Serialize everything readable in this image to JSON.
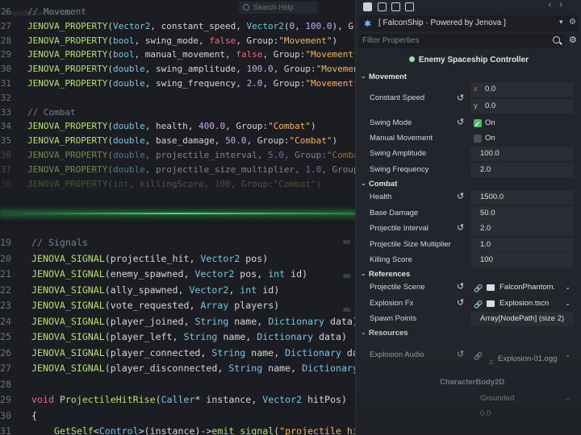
{
  "editor": {
    "ghost_title": "ProjectileController.cpp",
    "search_placeholder": "Search Help",
    "top_lines": [
      {
        "n": "26",
        "tokens": [
          [
            "cm",
            "// Movement"
          ]
        ]
      },
      {
        "n": "27",
        "tokens": [
          [
            "fn",
            "JENOVA_PROPERTY"
          ],
          [
            "pl",
            "("
          ],
          [
            "ty",
            "Vector2"
          ],
          [
            "pl",
            ", constant_speed, "
          ],
          [
            "ty",
            "Vector2"
          ],
          [
            "pl",
            "("
          ],
          [
            "num",
            "0"
          ],
          [
            "pl",
            ", "
          ],
          [
            "num",
            "100.0"
          ],
          [
            "pl",
            "), Group:"
          ]
        ]
      },
      {
        "n": "28",
        "tokens": [
          [
            "fn",
            "JENOVA_PROPERTY"
          ],
          [
            "pl",
            "("
          ],
          [
            "ty",
            "bool"
          ],
          [
            "pl",
            ", swing_mode, "
          ],
          [
            "kw",
            "false"
          ],
          [
            "pl",
            ", Group:"
          ],
          [
            "str",
            "\"Movement\""
          ],
          [
            "pl",
            ")"
          ]
        ]
      },
      {
        "n": "29",
        "tokens": [
          [
            "fn",
            "JENOVA_PROPERTY"
          ],
          [
            "pl",
            "("
          ],
          [
            "ty",
            "bool"
          ],
          [
            "pl",
            ", manual_movement, "
          ],
          [
            "kw",
            "false"
          ],
          [
            "pl",
            ", Group:"
          ],
          [
            "str",
            "\"Movement\""
          ],
          [
            "pl",
            ")"
          ]
        ]
      },
      {
        "n": "30",
        "tokens": [
          [
            "fn",
            "JENOVA_PROPERTY"
          ],
          [
            "pl",
            "("
          ],
          [
            "ty",
            "double"
          ],
          [
            "pl",
            ", swing_amplitude, "
          ],
          [
            "num",
            "100.0"
          ],
          [
            "pl",
            ", Group:"
          ],
          [
            "str",
            "\"Movement\""
          ],
          [
            "pl",
            ")"
          ]
        ]
      },
      {
        "n": "31",
        "tokens": [
          [
            "fn",
            "JENOVA_PROPERTY"
          ],
          [
            "pl",
            "("
          ],
          [
            "ty",
            "double"
          ],
          [
            "pl",
            ", swing_frequency, "
          ],
          [
            "num",
            "2.0"
          ],
          [
            "pl",
            ", Group:"
          ],
          [
            "str",
            "\"Movement\""
          ],
          [
            "pl",
            ")"
          ]
        ]
      },
      {
        "n": "32",
        "tokens": []
      },
      {
        "n": "33",
        "tokens": [
          [
            "cm",
            "// Combat"
          ]
        ]
      },
      {
        "n": "34",
        "tokens": [
          [
            "fn",
            "JENOVA_PROPERTY"
          ],
          [
            "pl",
            "("
          ],
          [
            "ty",
            "double"
          ],
          [
            "pl",
            ", health, "
          ],
          [
            "num",
            "400.0"
          ],
          [
            "pl",
            ", Group:"
          ],
          [
            "str",
            "\"Combat\""
          ],
          [
            "pl",
            ")"
          ]
        ]
      },
      {
        "n": "35",
        "tokens": [
          [
            "fn",
            "JENOVA_PROPERTY"
          ],
          [
            "pl",
            "("
          ],
          [
            "ty",
            "double"
          ],
          [
            "pl",
            ", base_damage, "
          ],
          [
            "num",
            "50.0"
          ],
          [
            "pl",
            ", Group:"
          ],
          [
            "str",
            "\"Combat\""
          ],
          [
            "pl",
            ")"
          ]
        ]
      },
      {
        "n": "36",
        "fade": "fade-1",
        "tokens": [
          [
            "fn",
            "JENOVA_PROPERTY"
          ],
          [
            "pl",
            "("
          ],
          [
            "ty",
            "double"
          ],
          [
            "pl",
            ", projectile_interval, "
          ],
          [
            "num",
            "5.0"
          ],
          [
            "pl",
            ", Group:"
          ],
          [
            "str",
            "\"Combat\""
          ],
          [
            "pl",
            ")"
          ]
        ]
      },
      {
        "n": "37",
        "fade": "fade-1",
        "tokens": [
          [
            "fn",
            "JENOVA_PROPERTY"
          ],
          [
            "pl",
            "("
          ],
          [
            "ty",
            "double"
          ],
          [
            "pl",
            ", projectile_size_multiplier, "
          ],
          [
            "num",
            "1.0"
          ],
          [
            "pl",
            ", Group:"
          ],
          [
            "str",
            "\"Com"
          ]
        ]
      },
      {
        "n": "38",
        "fade": "fade-2",
        "tokens": [
          [
            "fn",
            "JENOVA_PROPERTY"
          ],
          [
            "pl",
            "("
          ],
          [
            "ty",
            "int"
          ],
          [
            "pl",
            ", killingScore, "
          ],
          [
            "num",
            "100"
          ],
          [
            "pl",
            ", Group:"
          ],
          [
            "str",
            "\"Combat\""
          ],
          [
            "pl",
            ")"
          ]
        ]
      }
    ],
    "bottom_lines": [
      {
        "n": "19",
        "tokens": [
          [
            "cm",
            "// Signals"
          ]
        ]
      },
      {
        "n": "20",
        "tokens": [
          [
            "fn",
            "JENOVA_SIGNAL"
          ],
          [
            "pl",
            "(projectile_hit, "
          ],
          [
            "ty",
            "Vector2"
          ],
          [
            "pl",
            " pos)"
          ]
        ]
      },
      {
        "n": "21",
        "tokens": [
          [
            "fn",
            "JENOVA_SIGNAL"
          ],
          [
            "pl",
            "(enemy_spawned, "
          ],
          [
            "ty",
            "Vector2"
          ],
          [
            "pl",
            " pos, "
          ],
          [
            "ty",
            "int"
          ],
          [
            "pl",
            " id)"
          ]
        ]
      },
      {
        "n": "22",
        "tokens": [
          [
            "fn",
            "JENOVA_SIGNAL"
          ],
          [
            "pl",
            "(ally_spawned, "
          ],
          [
            "ty",
            "Vector2"
          ],
          [
            "pl",
            ", "
          ],
          [
            "ty",
            "int"
          ],
          [
            "pl",
            " id)"
          ]
        ]
      },
      {
        "n": "23",
        "tokens": [
          [
            "fn",
            "JENOVA_SIGNAL"
          ],
          [
            "pl",
            "(vote_requested, "
          ],
          [
            "ty",
            "Array"
          ],
          [
            "pl",
            " players)"
          ]
        ]
      },
      {
        "n": "24",
        "tokens": [
          [
            "fn",
            "JENOVA_SIGNAL"
          ],
          [
            "pl",
            "(player_joined, "
          ],
          [
            "ty",
            "String"
          ],
          [
            "pl",
            " name, "
          ],
          [
            "ty",
            "Dictionary"
          ],
          [
            "pl",
            " data)"
          ]
        ]
      },
      {
        "n": "25",
        "tokens": [
          [
            "fn",
            "JENOVA_SIGNAL"
          ],
          [
            "pl",
            "(player_left, "
          ],
          [
            "ty",
            "String"
          ],
          [
            "pl",
            " name, "
          ],
          [
            "ty",
            "Dictionary"
          ],
          [
            "pl",
            " data)"
          ]
        ]
      },
      {
        "n": "26",
        "tokens": [
          [
            "fn",
            "JENOVA_SIGNAL"
          ],
          [
            "pl",
            "(player_connected, "
          ],
          [
            "ty",
            "String"
          ],
          [
            "pl",
            " name, "
          ],
          [
            "ty",
            "Dictionary"
          ],
          [
            "pl",
            " data)"
          ]
        ]
      },
      {
        "n": "27",
        "tokens": [
          [
            "fn",
            "JENOVA_SIGNAL"
          ],
          [
            "pl",
            "(player_disconnected, "
          ],
          [
            "ty",
            "String"
          ],
          [
            "pl",
            " name, "
          ],
          [
            "ty",
            "Dictionary"
          ],
          [
            "pl",
            " data)"
          ]
        ]
      },
      {
        "n": "28",
        "tokens": []
      },
      {
        "n": "29",
        "tokens": [
          [
            "kw",
            "void"
          ],
          [
            "pl",
            " "
          ],
          [
            "fn",
            "ProjectileHitRise"
          ],
          [
            "pl",
            "("
          ],
          [
            "ty",
            "Caller"
          ],
          [
            "pl",
            "* instance, "
          ],
          [
            "ty",
            "Vector2"
          ],
          [
            "pl",
            " hitPos)"
          ]
        ]
      },
      {
        "n": "30",
        "tokens": [
          [
            "pl",
            "{"
          ]
        ]
      },
      {
        "n": "31",
        "tokens": [
          [
            "pl",
            "    "
          ],
          [
            "fn",
            "GetSelf"
          ],
          [
            "pl",
            "<"
          ],
          [
            "ty",
            "Control"
          ],
          [
            "pl",
            ">(instance)->"
          ],
          [
            "fn",
            "emit_signal"
          ],
          [
            "pl",
            "("
          ],
          [
            "str",
            "\"projectile_hit\""
          ],
          [
            "pl",
            ", hitPos);"
          ]
        ]
      }
    ]
  },
  "colors": {
    "function": "#b7e06b",
    "type": "#6ec7e8",
    "keyword": "#ef6b7b",
    "number": "#c9a8f4",
    "string": "#f2b65b",
    "comment": "#7a7f89",
    "accent_green": "#39e37a",
    "checkbox_on": "#46c26c"
  },
  "inspector": {
    "nav_back": "‹",
    "nav_forward": "›",
    "object_title": "[ FalconShip · Powered by Jenova ]",
    "filter_placeholder": "Filter Properties",
    "script_title": "Enemy Spaceship Controller",
    "movement": {
      "header": "Movement",
      "constant_speed": {
        "label": "Constant Speed",
        "x_axis": "x",
        "x": "0.0",
        "y_axis": "y",
        "y": "0.0"
      },
      "swing_mode": {
        "label": "Swing Mode",
        "value": "On",
        "checked": true
      },
      "manual_movement": {
        "label": "Manual Movement",
        "value": "On",
        "checked": false
      },
      "swing_amplitude": {
        "label": "Swing Amplitude",
        "value": "100.0"
      },
      "swing_frequency": {
        "label": "Swing Frequency",
        "value": "2.0"
      }
    },
    "combat": {
      "header": "Combat",
      "health": {
        "label": "Health",
        "value": "1500.0"
      },
      "base_damage": {
        "label": "Base Damage",
        "value": "50.0"
      },
      "projectile_interval": {
        "label": "Projectile Interval",
        "value": "2.0"
      },
      "projectile_size_multiplier": {
        "label": "Projectile Size Multiplier",
        "value": "1.0"
      },
      "killing_score": {
        "label": "Killing Score",
        "value": "100"
      }
    },
    "references": {
      "header": "References",
      "projectile_scene": {
        "label": "Projectile Scene",
        "value": "FalconPhantom."
      },
      "explosion_fx": {
        "label": "Explosion Fx",
        "value": "Explosion.tscn"
      },
      "spawn_points": {
        "label": "Spawn Points",
        "value": "Array[NodePath] (size 2)"
      }
    },
    "resources": {
      "header": "Resources",
      "explosion_audio": {
        "label": "Explosion Audio",
        "value": "Explosion-01.ogg"
      }
    },
    "faded": {
      "node_class": "CharacterBody2D",
      "dropdown_value": "Grounded",
      "number_value": "0.0"
    }
  }
}
